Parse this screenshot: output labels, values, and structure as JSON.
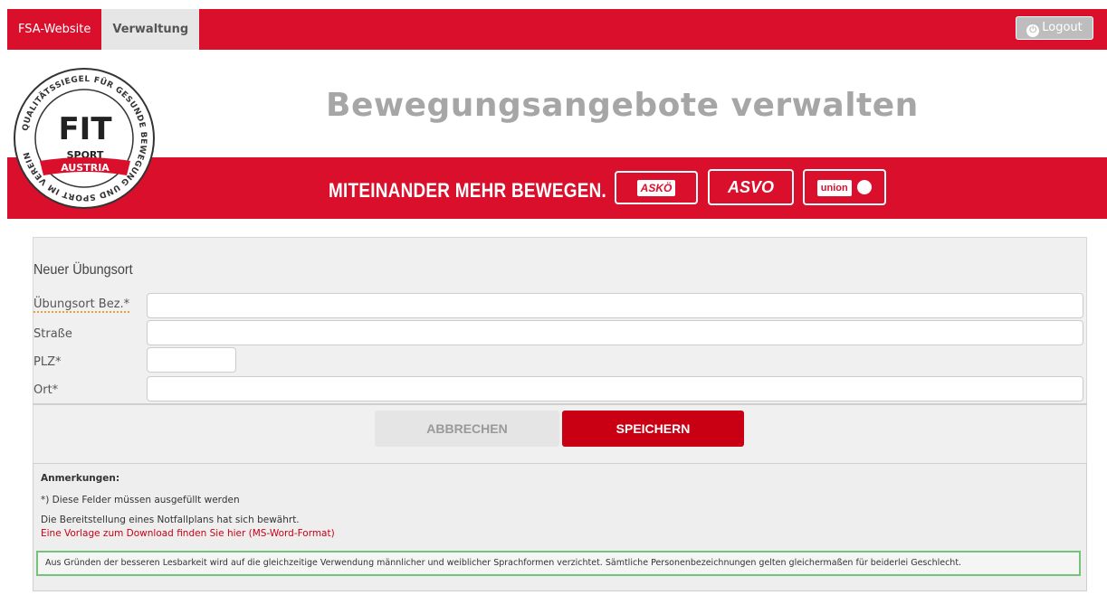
{
  "nav": {
    "items": [
      {
        "label": "FSA-Website"
      },
      {
        "label": "Verwaltung",
        "active": true
      }
    ],
    "logout_label": "Logout"
  },
  "header": {
    "title": "Bewegungsangebote verwalten",
    "slogan": "MITEINANDER MEHR BEWEGEN.",
    "partners": [
      "ASKÖ",
      "ASVO",
      "union"
    ],
    "logo": {
      "ring_text": "QUALITÄTSSIEGEL FÜR GESUNDE BEWEGUNG UND SPORT IM VEREIN",
      "main": "FIT",
      "sport": "SPORT",
      "country": "AUSTRIA"
    }
  },
  "form": {
    "title": "Neuer Übungsort",
    "fields": [
      {
        "label": "Übungsort Bez.*",
        "value": "",
        "placeholder": ""
      },
      {
        "label": "Straße",
        "value": "",
        "placeholder": ""
      },
      {
        "label": "PLZ*",
        "value": "",
        "placeholder": ""
      },
      {
        "label": "Ort*",
        "value": "",
        "placeholder": ""
      }
    ],
    "cancel_label": "ABBRECHEN",
    "save_label": "SPEICHERN"
  },
  "notes": {
    "heading": "Anmerkungen:",
    "required_note": "*) Diese Felder müssen ausgefüllt werden",
    "emergency_note": "Die Bereitstellung eines Notfallplans hat sich bewährt.",
    "download_link": "Eine Vorlage zum Download finden Sie hier (MS-Word-Format)",
    "gender_note": "Aus Gründen der besseren Lesbarkeit wird auf die gleichzeitige Verwendung männlicher und weiblicher Sprachformen verzichtet. Sämtliche Personenbezeichnungen gelten gleichermaßen für beiderlei Geschlecht."
  },
  "colors": {
    "brand_red": "#d90f2b",
    "save_red": "#c90014",
    "note_border_green": "#73c47a"
  }
}
